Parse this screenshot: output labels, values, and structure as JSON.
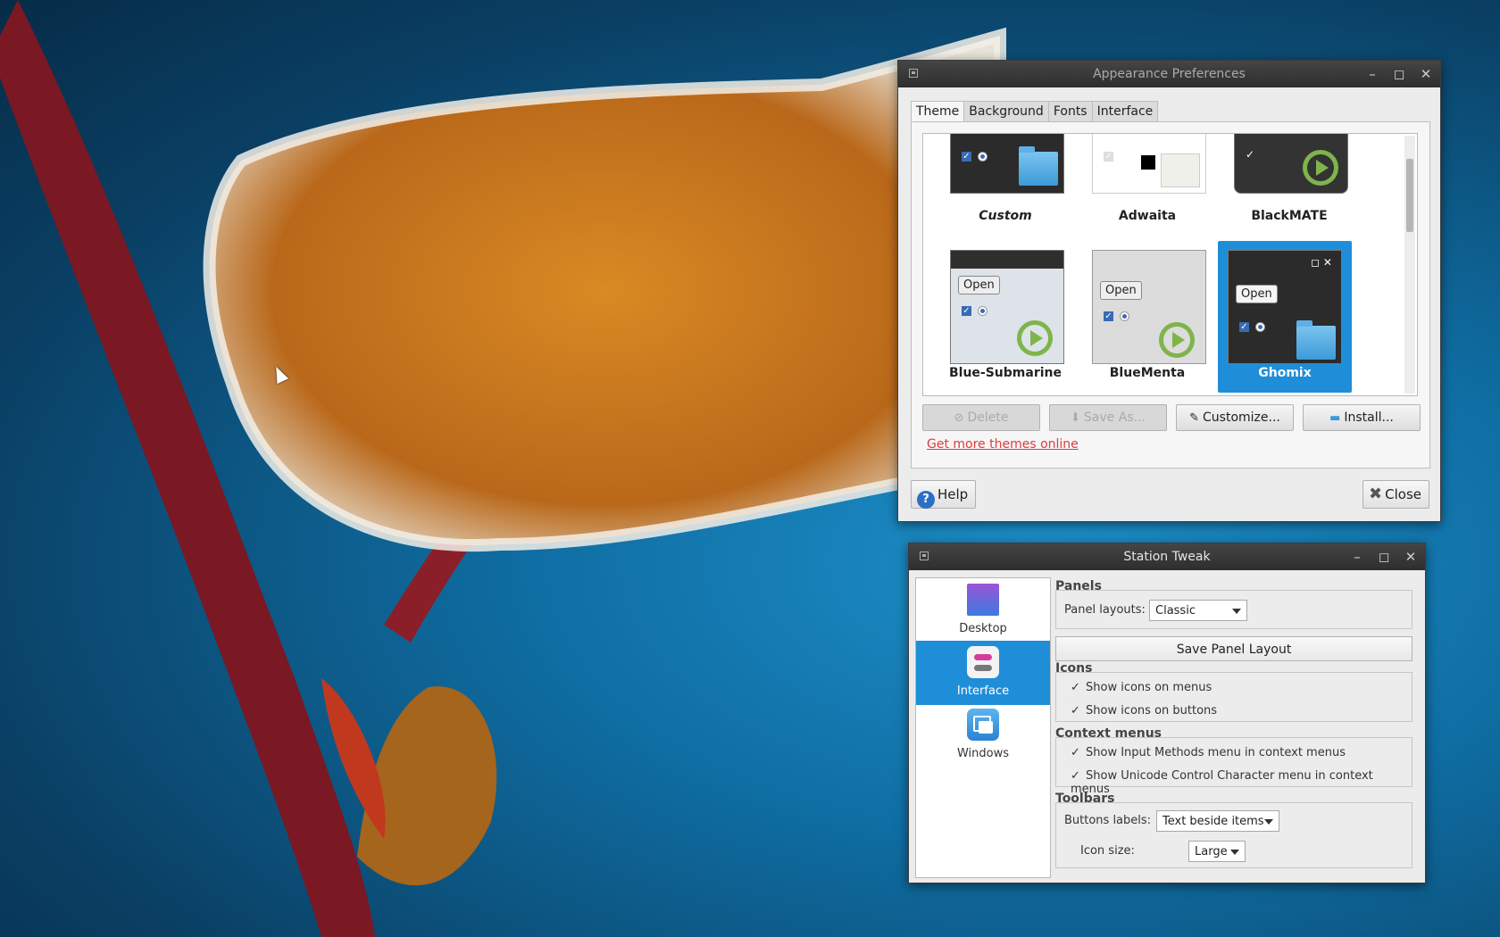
{
  "appearance": {
    "title": "Appearance Preferences",
    "tabs": [
      "Theme",
      "Background",
      "Fonts",
      "Interface"
    ],
    "themes": [
      {
        "name": "Custom"
      },
      {
        "name": "Adwaita"
      },
      {
        "name": "BlackMATE"
      },
      {
        "name": "Blue-Submarine"
      },
      {
        "name": "BlueMenta"
      },
      {
        "name": "Ghomix"
      }
    ],
    "thumb_open_label": "Open",
    "buttons": {
      "delete": "Delete",
      "save_as": "Save As...",
      "customize": "Customize...",
      "install": "Install..."
    },
    "more_themes_link": "Get more themes online",
    "help": "Help",
    "close": "Close"
  },
  "tweak": {
    "title": "Station Tweak",
    "sidebar": [
      {
        "label": "Desktop"
      },
      {
        "label": "Interface"
      },
      {
        "label": "Windows"
      }
    ],
    "panels": {
      "heading": "Panels",
      "layouts_label": "Panel layouts:",
      "layouts_value": "Classic",
      "save_button": "Save Panel Layout"
    },
    "icons": {
      "heading": "Icons",
      "items": [
        "Show icons on menus",
        "Show icons on buttons"
      ]
    },
    "context_menus": {
      "heading": "Context menus",
      "items": [
        "Show Input Methods menu in context menus",
        "Show Unicode Control Character menu in context menus"
      ]
    },
    "toolbars": {
      "heading": "Toolbars",
      "buttons_label": "Buttons labels:",
      "buttons_value": "Text beside items",
      "icon_size_label": "Icon size:",
      "icon_size_value": "Large"
    }
  },
  "colors": {
    "selection": "#1f8ed8",
    "link": "#e03a3a"
  }
}
